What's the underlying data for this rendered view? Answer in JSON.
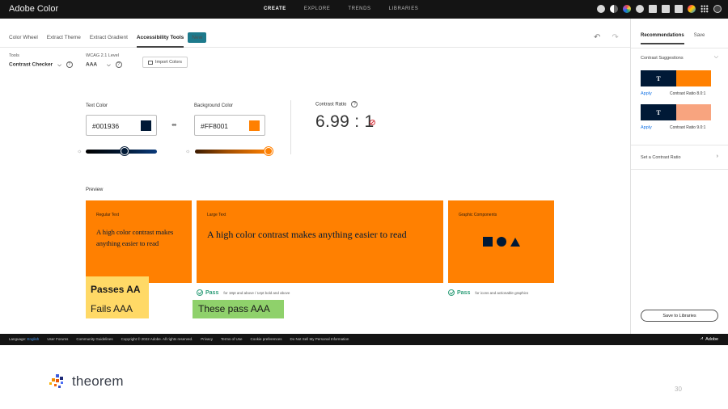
{
  "app": {
    "title": "Adobe Color"
  },
  "topnav": {
    "items": [
      "CREATE",
      "EXPLORE",
      "TRENDS",
      "LIBRARIES"
    ],
    "active": "CREATE"
  },
  "subnav": {
    "tabs": [
      "Color Wheel",
      "Extract Theme",
      "Extract Gradient",
      "Accessibility Tools"
    ],
    "active": "Accessibility Tools",
    "badge": "New"
  },
  "tools": {
    "tools_label": "Tools",
    "tools_value": "Contrast Checker",
    "wcag_label": "WCAG 2.1 Level",
    "wcag_value": "AAA",
    "import_label": "Import Colors"
  },
  "checker": {
    "text_color_label": "Text Color",
    "text_color_hex": "#001936",
    "text_color": "#001936",
    "bg_color_label": "Background Color",
    "bg_color_hex": "#FF8001",
    "bg_color": "#FF8001",
    "contrast_label": "Contrast Ratio",
    "contrast_value": "6.99 : 1",
    "text_slider_level": 0.55,
    "bg_slider_level": 1.0
  },
  "preview": {
    "label": "Preview",
    "cards": [
      {
        "small": "Regular Text",
        "big": "A high color contrast makes anything easier to read"
      },
      {
        "small": "Large Text",
        "big": "A high color contrast makes anything easier to read"
      },
      {
        "small": "Graphic Components"
      }
    ],
    "pass_word": "Pass",
    "large_text_note": "for 18pt and above / 14pt bold and above",
    "graphics_note": "for icons and actionable graphics"
  },
  "annotations": {
    "passes_aa": "Passes AA",
    "fails_aaa": "Fails AAA",
    "these_pass": "These pass AAA"
  },
  "panel": {
    "tab_recommendations": "Recommendations",
    "tab_save": "Save",
    "suggestions_title": "Contrast Suggestions",
    "suggestions": [
      {
        "letter": "T",
        "swatch": "#FF8001",
        "apply": "Apply",
        "ratio": "Contrast Ratio 8.0:1"
      },
      {
        "letter": "T",
        "swatch": "#F8A47F",
        "apply": "Apply",
        "ratio": "Contrast Ratio 9.0:1"
      }
    ],
    "set_ratio": "Set a Contrast Ratio",
    "save_libraries": "Save to Libraries"
  },
  "footer": {
    "language_label": "Language:",
    "language_value": "English",
    "links": [
      "User Forums",
      "Community Guidelines",
      "Copyright © 2022 Adobe. All rights reserved.",
      "Privacy",
      "Terms of Use",
      "Cookie preferences",
      "Do Not Sell My Personal Information"
    ],
    "brand": "Adobe"
  },
  "slide": {
    "logo_text": "theorem",
    "page_number": "30"
  }
}
